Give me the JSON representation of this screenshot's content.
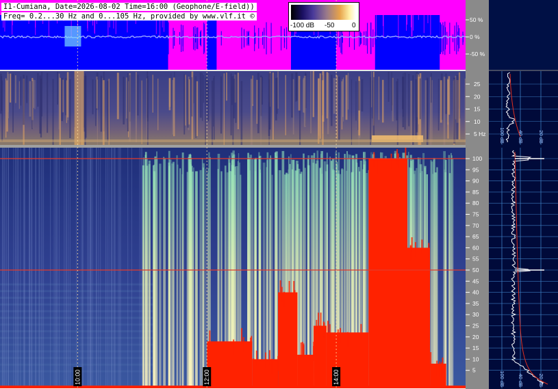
{
  "header": {
    "line1": "I1-Cumiana, Date=2026-08-02 Time=16:00 (Geophone/E-field))",
    "line2": "Freq= 0.2...30 Hz and 0...105 Hz, provided by www.vlf.it ©"
  },
  "colorbar": {
    "labels": [
      "-100 dB",
      "-50",
      "0"
    ],
    "colors": [
      "#000000",
      "#1b1063",
      "#4a3a9a",
      "#9a7a8a",
      "#e7a34a",
      "#fff1a8",
      "#ffffff"
    ]
  },
  "colors": {
    "geophone_background": "#ff00ff",
    "geophone_trace": "#0000ff",
    "spectrogram_low": "#2b3a8c",
    "spectrogram_mid": "#7fd3b0",
    "spectrogram_high": "#ff2200",
    "side_panel_background": "#000a3a",
    "axis_strip": "#8a8a8a"
  },
  "chart_data": [
    {
      "type": "area",
      "panel": "geophone-amplitude",
      "y_tick_labels": [
        "50 %",
        "0 %",
        "-50 %"
      ],
      "y_ticks": [
        50,
        0,
        -50
      ],
      "ylim": [
        -100,
        100
      ],
      "x_range_hours": [
        8.8,
        16.0
      ],
      "activity_bursts": [
        {
          "start": 11.4,
          "end": 12.0
        },
        {
          "start": 12.15,
          "end": 13.3
        },
        {
          "start": 14.0,
          "end": 14.6
        },
        {
          "start": 15.6,
          "end": 16.0
        }
      ],
      "background_color": "#ff00ff",
      "trace_color": "#0000ff"
    },
    {
      "type": "heatmap",
      "panel": "low-frequency-spectrogram",
      "y_unit": "Hz",
      "y_ticks": [
        5,
        10,
        15,
        20,
        25
      ],
      "y_tick_labels": [
        "5 Hz",
        "10",
        "15",
        "20",
        "25"
      ],
      "ylim": [
        0.2,
        30
      ],
      "x_range_hours": [
        8.8,
        16.0
      ],
      "cursor_hours": [
        10.0,
        12.0,
        14.0
      ]
    },
    {
      "type": "heatmap",
      "panel": "high-frequency-spectrogram",
      "y_ticks": [
        5,
        10,
        15,
        20,
        25,
        30,
        35,
        40,
        45,
        50,
        55,
        60,
        65,
        70,
        75,
        80,
        85,
        90,
        95,
        100
      ],
      "ylim": [
        0,
        105
      ],
      "x_range_hours": [
        8.8,
        16.0
      ],
      "time_labels": [
        {
          "hour": 10.0,
          "label": "10:00"
        },
        {
          "hour": 12.0,
          "label": "12:00"
        },
        {
          "hour": 14.0,
          "label": "14:00"
        }
      ],
      "interference_lines_hz": [
        50,
        100
      ],
      "red_saturation_regions": [
        {
          "start": 12.0,
          "end": 12.7,
          "top_hz": 18
        },
        {
          "start": 12.7,
          "end": 13.1,
          "top_hz": 10
        },
        {
          "start": 13.1,
          "end": 13.4,
          "top_hz": 40
        },
        {
          "start": 13.4,
          "end": 13.65,
          "top_hz": 12
        },
        {
          "start": 13.65,
          "end": 13.85,
          "top_hz": 25
        },
        {
          "start": 13.85,
          "end": 14.5,
          "top_hz": 22
        },
        {
          "start": 14.5,
          "end": 15.1,
          "top_hz": 100
        },
        {
          "start": 15.1,
          "end": 15.45,
          "top_hz": 60
        },
        {
          "start": 15.45,
          "end": 15.7,
          "top_hz": 8
        }
      ]
    },
    {
      "type": "line",
      "panel": "low-frequency-profile",
      "x_ticks": [
        100,
        40,
        20
      ],
      "x_tick_labels": [
        "100 dB",
        "40 dB",
        "20 dB"
      ],
      "profile_peak_hz": 10
    },
    {
      "type": "line",
      "panel": "high-frequency-profile",
      "x_ticks": [
        100,
        40,
        20
      ],
      "x_tick_labels": [
        "100 dB",
        "40 dB",
        "20 dB"
      ],
      "peaks_hz": [
        50,
        100
      ]
    }
  ]
}
